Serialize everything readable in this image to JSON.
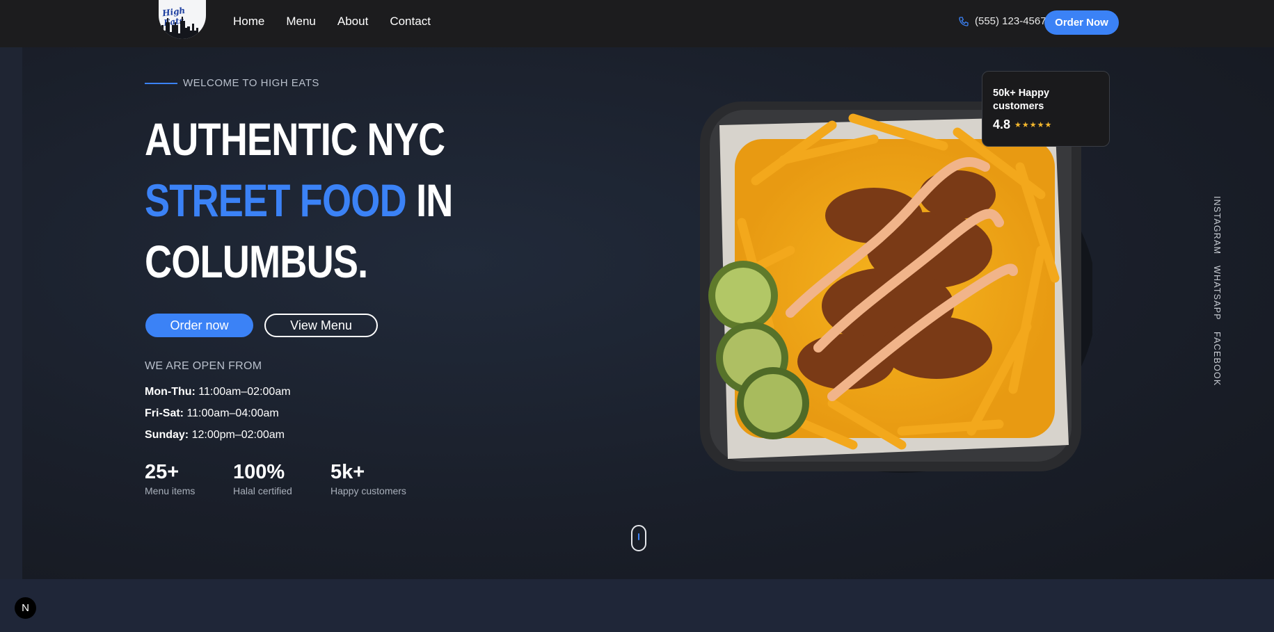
{
  "nav": {
    "links": [
      "Home",
      "Menu",
      "About",
      "Contact"
    ],
    "phone": "(555) 123-4567",
    "order_label": "Order Now",
    "logo_text": "High Eats"
  },
  "hero": {
    "welcome": "WELCOME TO HIGH EATS",
    "headline": {
      "line1": "AUTHENTIC NYC",
      "line2_blue": "STREET FOOD",
      "line2_rest": " IN",
      "line3": "COLUMBUS."
    },
    "order_now": "Order now",
    "view_menu": "View Menu",
    "open_title": "WE ARE OPEN FROM",
    "hours": [
      {
        "day": "Mon-Thu:",
        "time": " 11:00am–02:00am"
      },
      {
        "day": "Fri-Sat:",
        "time": " 11:00am–04:00am"
      },
      {
        "day": "Sunday:",
        "time": " 12:00pm–02:00am"
      }
    ],
    "stats": [
      {
        "num": "25+",
        "label": "Menu items"
      },
      {
        "num": "100%",
        "label": "Halal certified"
      },
      {
        "num": "5k+",
        "label": "Happy customers"
      }
    ]
  },
  "rating_card": {
    "title": "50k+ Happy customers",
    "score": "4.8",
    "stars": "★★★★★"
  },
  "social": [
    "INSTAGRAM",
    "WHATSAPP",
    "FACEBOOK"
  ],
  "badge": "N",
  "colors": {
    "accent": "#3b82f6",
    "nav_bg": "#1c1c1e",
    "star": "#f5b82e"
  }
}
